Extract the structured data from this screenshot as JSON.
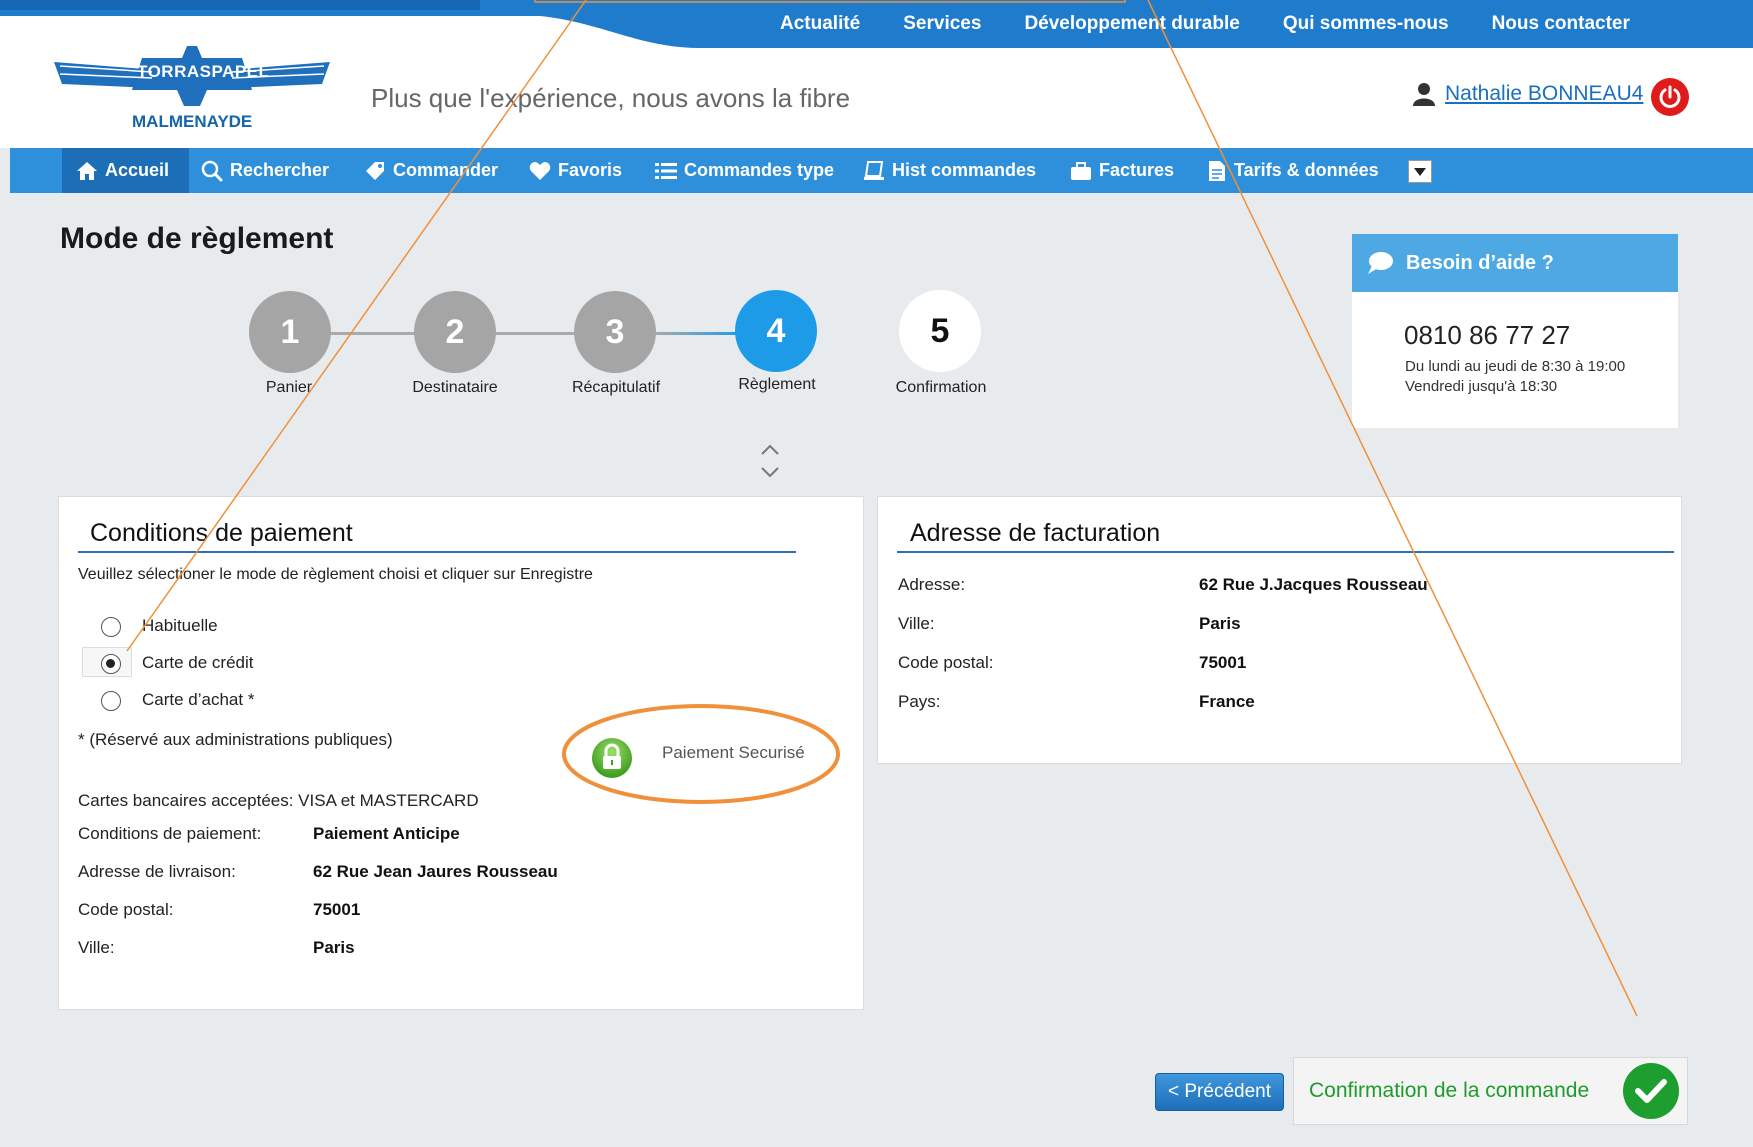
{
  "top_nav": [
    "Actualité",
    "Services",
    "Développement durable",
    "Qui sommes-nous",
    "Nous contacter"
  ],
  "logo": {
    "top": "TORRASPAPEL",
    "bottom": "MALMENAYDE"
  },
  "tagline": "Plus que l'expérience, nous avons la fibre",
  "user": {
    "name": "Nathalie BONNEAU4"
  },
  "main_nav": [
    {
      "label": "Accueil",
      "icon": "home-icon"
    },
    {
      "label": "Rechercher",
      "icon": "search-icon"
    },
    {
      "label": "Commander",
      "icon": "tag-icon"
    },
    {
      "label": "Favoris",
      "icon": "heart-icon"
    },
    {
      "label": "Commandes type",
      "icon": "list-icon"
    },
    {
      "label": "Hist commandes",
      "icon": "history-icon"
    },
    {
      "label": "Factures",
      "icon": "briefcase-icon"
    },
    {
      "label": "Tarifs & données",
      "icon": "document-icon"
    }
  ],
  "page_title": "Mode de règlement",
  "steps": [
    {
      "number": "1",
      "label": "Panier"
    },
    {
      "number": "2",
      "label": "Destinataire"
    },
    {
      "number": "3",
      "label": "Récapitulatif"
    },
    {
      "number": "4",
      "label": "Règlement"
    },
    {
      "number": "5",
      "label": "Confirmation"
    }
  ],
  "active_step": 4,
  "help": {
    "title": "Besoin d’aide ?",
    "phone": "0810 86 77 27",
    "hours_line1": "Du lundi au jeudi de 8:30 à 19:00",
    "hours_line2": "Vendredi jusqu'à 18:30"
  },
  "payment": {
    "title": "Conditions de paiement",
    "instruction": "Veuillez sélectioner le mode de règlement choisi et cliquer sur Enregistre",
    "options": [
      {
        "label": "Habituelle",
        "checked": false
      },
      {
        "label": "Carte de crédit",
        "checked": true
      },
      {
        "label": "Carte d’achat *",
        "checked": false
      }
    ],
    "note": "* (Réservé aux administrations publiques)",
    "secure_label": "Paiement Securisé",
    "cards_accepted": "Cartes bancaires acceptées: VISA et MASTERCARD",
    "details": [
      {
        "label": "Conditions de paiement:",
        "value": "Paiement Anticipe"
      },
      {
        "label": "Adresse de livraison:",
        "value": "62 Rue Jean Jaures Rousseau"
      },
      {
        "label": "Code postal:",
        "value": "75001"
      },
      {
        "label": "Ville:",
        "value": "Paris"
      }
    ]
  },
  "billing": {
    "title": "Adresse de facturation",
    "rows": [
      {
        "label": "Adresse:",
        "value": "62 Rue J.Jacques Rousseau"
      },
      {
        "label": "Ville:",
        "value": "Paris"
      },
      {
        "label": "Code postal:",
        "value": "75001"
      },
      {
        "label": "Pays:",
        "value": "France"
      }
    ]
  },
  "buttons": {
    "previous": "< Précédent",
    "confirm": "Confirmation de la commande"
  },
  "colors": {
    "nav_blue": "#2e8fda",
    "active_step": "#1e9be8",
    "inactive_step": "#a5a5a5",
    "confirm_green": "#1d9e2e",
    "annotation_orange": "#f0903a"
  }
}
